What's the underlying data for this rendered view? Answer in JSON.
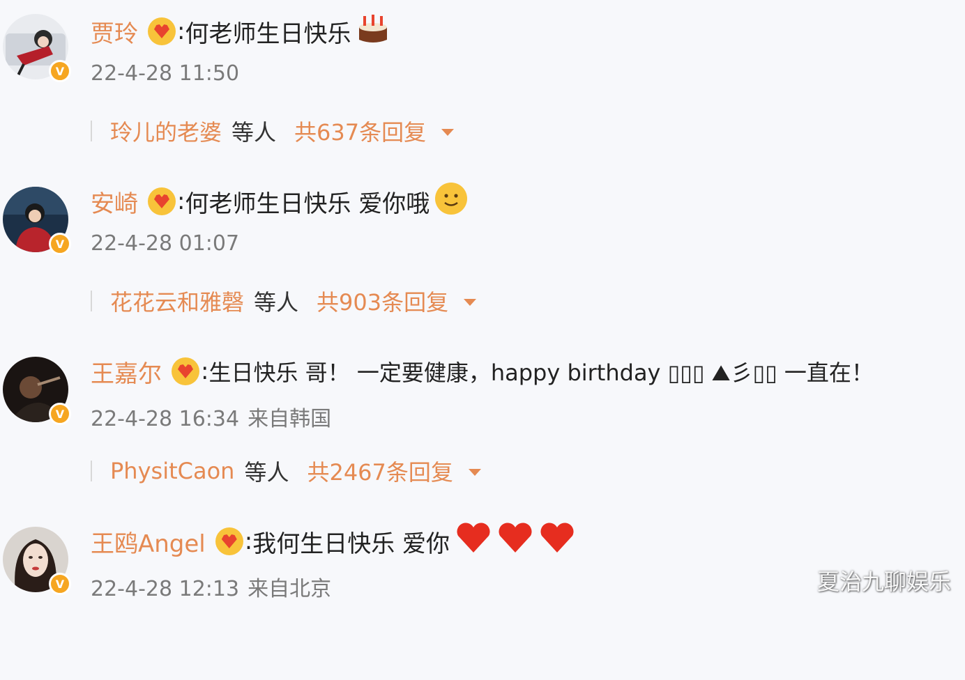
{
  "comments": [
    {
      "username": "贾玲",
      "colon": ":",
      "text": "何老师生日快乐",
      "trailing_emoji": "cake-emoji",
      "time": "22-4-28 11:50",
      "location": "",
      "reply_users": "玲儿的老婆",
      "reply_etc": "等人",
      "reply_count": "共637条回复"
    },
    {
      "username": "安崎",
      "colon": ":",
      "text": "何老师生日快乐 爱你哦",
      "trailing_emoji": "smile-emoji",
      "time": "22-4-28 01:07",
      "location": "",
      "reply_users": "花花云和雅磬",
      "reply_etc": "等人",
      "reply_count": "共903条回复"
    },
    {
      "username": "王嘉尔",
      "colon": ":",
      "text": "生日快乐 哥！ 一定要健康，happy birthday ▯▯▯ ⛰彡▯▯ 一直在！",
      "trailing_emoji": "",
      "time": "22-4-28 16:34",
      "location": "来自韩国",
      "reply_users": "PhysitCaon",
      "reply_etc": "等人",
      "reply_count": "共2467条回复"
    },
    {
      "username": "王鸥Angel",
      "colon": ":",
      "text": "我何生日快乐 爱你",
      "trailing_emoji": "hearts-emoji",
      "time": "22-4-28 12:13",
      "location": "来自北京",
      "reply_users": "",
      "reply_etc": "",
      "reply_count": ""
    }
  ],
  "watermark": "夏治九聊娱乐",
  "colors": {
    "username": "#e58a52",
    "timestamp": "#7a7a7a",
    "verified_badge": "#f6a621",
    "fan_badge": "#f8c33a"
  }
}
